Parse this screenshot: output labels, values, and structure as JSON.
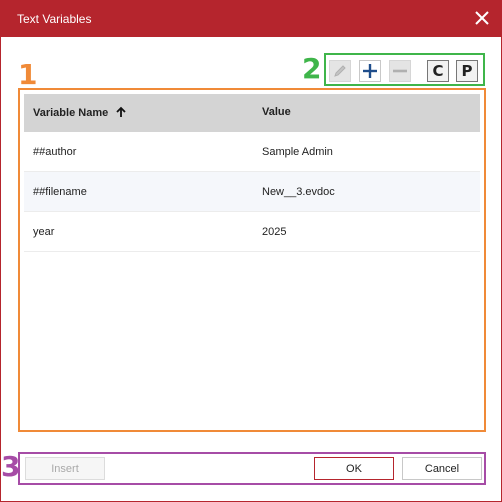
{
  "dialog": {
    "title": "Text Variables",
    "close_icon": "close-icon"
  },
  "annotations": [
    {
      "label": "1",
      "color": "#f08a38"
    },
    {
      "label": "2",
      "color": "#3fb54a"
    },
    {
      "label": "3",
      "color": "#a64ca6"
    }
  ],
  "toolbar": {
    "edit_icon": "pencil-icon",
    "add_icon": "plus-icon",
    "remove_icon": "minus-icon",
    "copy_label": "C",
    "paste_label": "P"
  },
  "table": {
    "columns": [
      "Variable Name",
      "Value"
    ],
    "sort_icon": "arrow-up-icon",
    "rows": [
      {
        "name": "##author",
        "value": "Sample Admin"
      },
      {
        "name": "##filename",
        "value": "New__3.evdoc"
      },
      {
        "name": "year",
        "value": "2025"
      }
    ]
  },
  "footer": {
    "insert_label": "Insert",
    "ok_label": "OK",
    "cancel_label": "Cancel"
  },
  "colors": {
    "titlebar": "#b5252d",
    "table_frame": "#f08a38",
    "toolbar_frame": "#3fb54a",
    "footer_frame": "#a64ca6"
  }
}
